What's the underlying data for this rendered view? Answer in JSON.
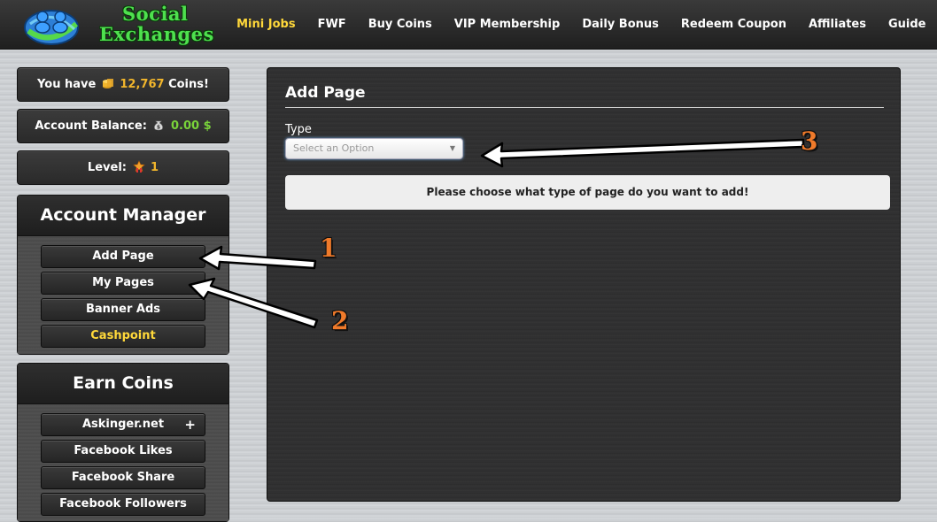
{
  "header": {
    "logo_line1": "Social",
    "logo_line2": "Exchanges",
    "nav": [
      {
        "label": "Mini Jobs"
      },
      {
        "label": "FWF"
      },
      {
        "label": "Buy Coins"
      },
      {
        "label": "VIP Membership"
      },
      {
        "label": "Daily Bonus"
      },
      {
        "label": "Redeem Coupon"
      },
      {
        "label": "Affiliates"
      },
      {
        "label": "Guide"
      }
    ]
  },
  "stats": {
    "coins_prefix": "You have",
    "coins_value": "12,767",
    "coins_suffix": "Coins!",
    "balance_label": "Account Balance:",
    "balance_value": "0.00 $",
    "level_label": "Level:",
    "level_value": "1"
  },
  "account_manager": {
    "title": "Account Manager",
    "items": [
      {
        "label": "Add Page"
      },
      {
        "label": "My Pages"
      },
      {
        "label": "Banner Ads"
      },
      {
        "label": "Cashpoint"
      }
    ]
  },
  "earn_coins": {
    "title": "Earn Coins",
    "items": [
      {
        "label": "Askinger.net",
        "badge": "+"
      },
      {
        "label": "Facebook Likes"
      },
      {
        "label": "Facebook Share"
      },
      {
        "label": "Facebook Followers"
      }
    ]
  },
  "main": {
    "title": "Add Page",
    "type_label": "Type",
    "select_placeholder": "Select an Option",
    "notice": "Please choose what type of page do you want to add!"
  },
  "annotations": {
    "n1": "1",
    "n2": "2",
    "n3": "3"
  },
  "colors": {
    "accent_yellow": "#ffd83a",
    "coin_gold": "#f2b62c",
    "balance_green": "#79d33a",
    "logo_green": "#4ee04e",
    "annotation_orange": "#f07a2a"
  }
}
